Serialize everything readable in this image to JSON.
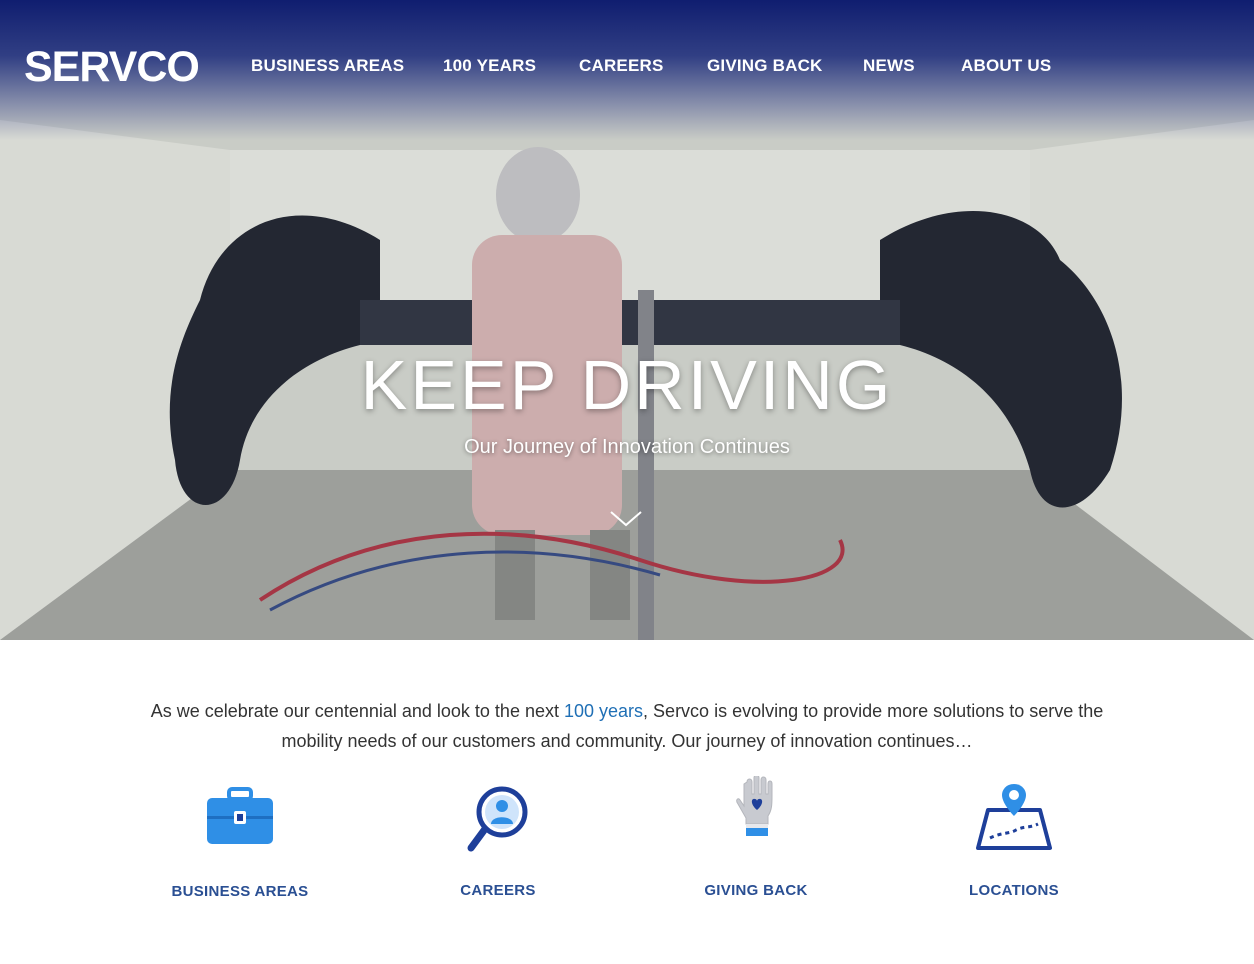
{
  "brand": {
    "logo_text": "SERVCO"
  },
  "nav": {
    "items": [
      {
        "label": "BUSINESS AREAS"
      },
      {
        "label": "100 YEARS"
      },
      {
        "label": "CAREERS"
      },
      {
        "label": "GIVING BACK"
      },
      {
        "label": "NEWS"
      },
      {
        "label": "ABOUT US"
      }
    ]
  },
  "hero": {
    "title": "KEEP DRIVING",
    "subtitle": "Our Journey of Innovation Continues",
    "scroll_icon": "chevron-down-icon"
  },
  "intro": {
    "text_before": "As we celebrate our centennial and look to the next ",
    "link_text": "100 years",
    "text_after": ", Servco is evolving to provide more solutions to serve the mobility needs of our customers and community. Our journey of innovation continues…"
  },
  "tiles": [
    {
      "label": "BUSINESS AREAS",
      "icon": "briefcase-icon"
    },
    {
      "label": "CAREERS",
      "icon": "magnifier-person-icon"
    },
    {
      "label": "GIVING BACK",
      "icon": "hand-heart-icon"
    },
    {
      "label": "LOCATIONS",
      "icon": "map-pin-icon"
    }
  ],
  "colors": {
    "nav_gradient_top": "#0c1a6e",
    "tile_label": "#2a4f93",
    "link": "#1f6fb5",
    "icon_blue": "#2f8fe6",
    "icon_navy": "#1e3f9a"
  }
}
